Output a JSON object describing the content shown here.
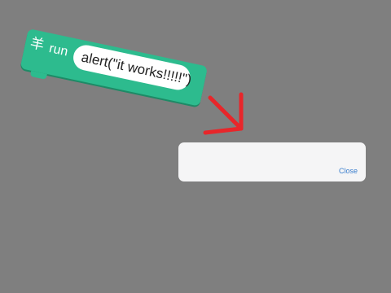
{
  "block": {
    "icon": "goat-glyph",
    "icon_text": "羊",
    "run_label": "run",
    "code_value": "alert(\"it works!!!!!\")",
    "color": "#2dbb8e"
  },
  "annotation": {
    "arrow_color": "#e8262a"
  },
  "alert_dialog": {
    "message": "",
    "close_label": "Close",
    "close_color": "#3a7ecd"
  }
}
